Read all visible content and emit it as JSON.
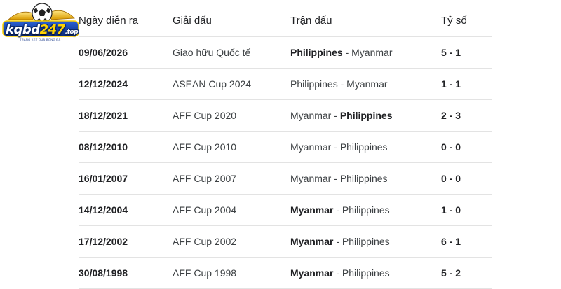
{
  "logo": {
    "brand": "kqbd",
    "number": "247",
    "tld": ".top",
    "tagline": "TRANG KẾT QUẢ BÓNG ĐÁ"
  },
  "table": {
    "headers": {
      "date": "Ngày diễn ra",
      "competition": "Giải đấu",
      "match": "Trận đấu",
      "score": "Tỷ số"
    },
    "rows": [
      {
        "date": "09/06/2026",
        "competition": "Giao hữu Quốc tế",
        "home": "Philippines",
        "sep": " - ",
        "away": "Myanmar",
        "winner": "home",
        "score": "5 - 1"
      },
      {
        "date": "12/12/2024",
        "competition": "ASEAN Cup 2024",
        "home": "Philippines",
        "sep": " - ",
        "away": "Myanmar",
        "winner": "none",
        "score": "1 - 1"
      },
      {
        "date": "18/12/2021",
        "competition": "AFF Cup 2020",
        "home": "Myanmar",
        "sep": " - ",
        "away": "Philippines",
        "winner": "away",
        "score": "2 - 3"
      },
      {
        "date": "08/12/2010",
        "competition": "AFF Cup 2010",
        "home": "Myanmar",
        "sep": " - ",
        "away": "Philippines",
        "winner": "none",
        "score": "0 - 0"
      },
      {
        "date": "16/01/2007",
        "competition": "AFF Cup 2007",
        "home": "Myanmar",
        "sep": " - ",
        "away": "Philippines",
        "winner": "none",
        "score": "0 - 0"
      },
      {
        "date": "14/12/2004",
        "competition": "AFF Cup 2004",
        "home": "Myanmar",
        "sep": " - ",
        "away": "Philippines",
        "winner": "home",
        "score": "1 - 0"
      },
      {
        "date": "17/12/2002",
        "competition": "AFF Cup 2002",
        "home": "Myanmar",
        "sep": " - ",
        "away": "Philippines",
        "winner": "home",
        "score": "6 - 1"
      },
      {
        "date": "30/08/1998",
        "competition": "AFF Cup 1998",
        "home": "Myanmar",
        "sep": " - ",
        "away": "Philippines",
        "winner": "home",
        "score": "5 - 2"
      }
    ]
  }
}
